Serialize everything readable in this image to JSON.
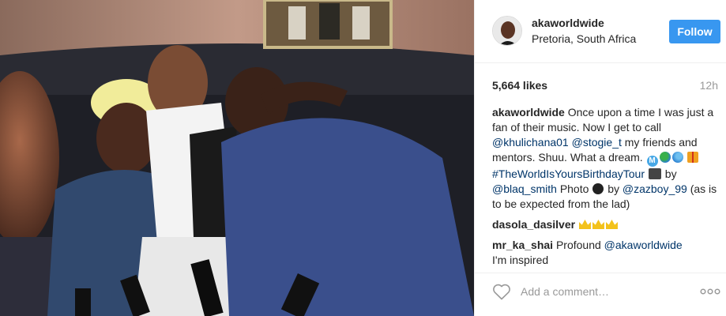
{
  "photo": {
    "alt_subject": "post-photo"
  },
  "header": {
    "username": "akaworldwide",
    "location": "Pretoria, South Africa",
    "follow_label": "Follow"
  },
  "meta": {
    "likes": "5,664 likes",
    "time": "12h"
  },
  "caption": {
    "username": "akaworldwide",
    "text_1": "Once upon a time I was just a fan of their music. Now I get to call",
    "mention_1": "@khulichana01",
    "mention_2": "@stogie_t",
    "text_2": "my friends and mentors. Shuu. What a dream.",
    "hashtag": "#TheWorldIsYoursBirthdayTour",
    "text_3": "by",
    "mention_3": "@blaq_smith",
    "text_4": "Photo",
    "text_5": "by",
    "mention_4": "@zazboy_99",
    "text_6": "(as is to be expected from the lad)"
  },
  "comments": [
    {
      "username": "dasola_dasilver",
      "text": ""
    },
    {
      "username": "mr_ka_shai",
      "text_before": "Profound",
      "mention": "@akaworldwide",
      "text_after": "I'm inspired"
    }
  ],
  "footer": {
    "add_comment_placeholder": "Add a comment…"
  },
  "colors": {
    "follow_button": "#3897f0",
    "link": "#003569",
    "muted": "#999999"
  },
  "icons": [
    "heart-icon",
    "more-options-icon"
  ]
}
